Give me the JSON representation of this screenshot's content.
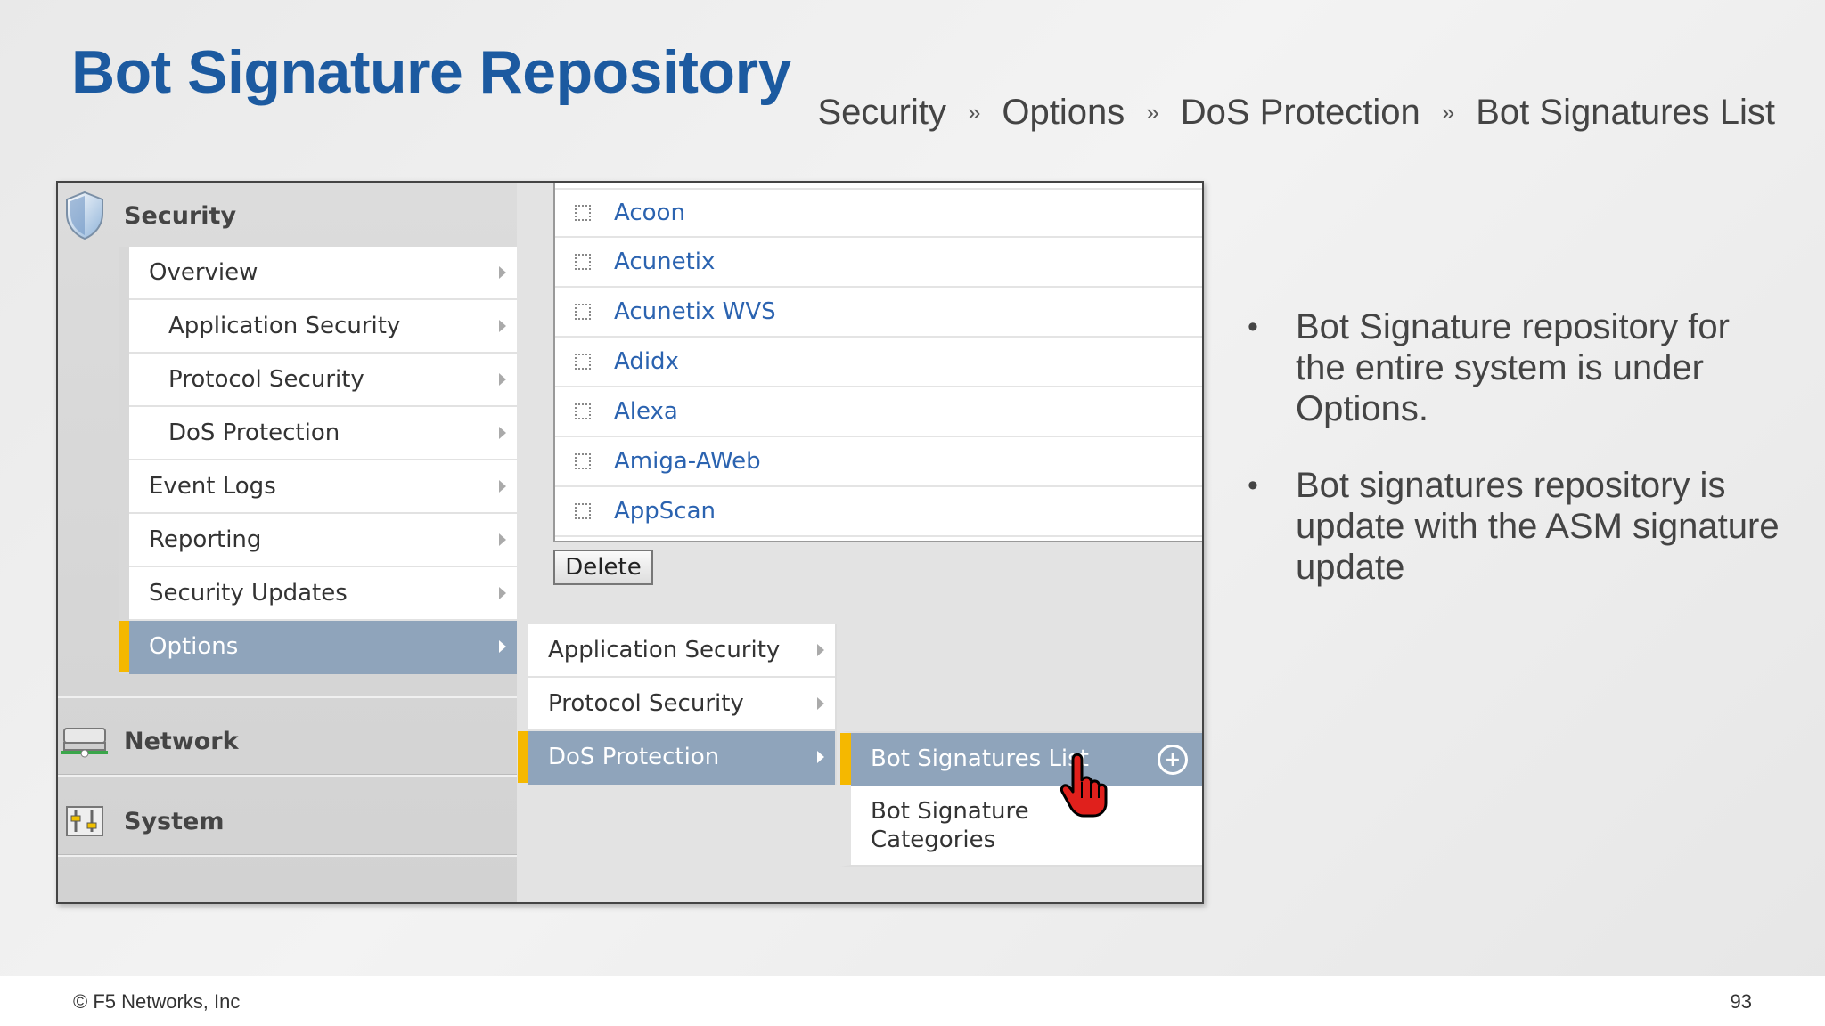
{
  "slide": {
    "title": "Bot Signature Repository",
    "breadcrumb": [
      "Security",
      "Options",
      "DoS Protection",
      "Bot Signatures List"
    ],
    "breadcrumb_separator": "»",
    "bullets": [
      "Bot Signature repository for the entire system is under Options.",
      "Bot signatures repository is update with the ASM signature update"
    ],
    "bullet_glyph": "•",
    "copyright": "© F5 Networks, Inc",
    "page_number": "93"
  },
  "screenshot": {
    "nav": {
      "security_label": "Security",
      "network_label": "Network",
      "system_label": "System",
      "security_items": [
        {
          "label": "Overview"
        },
        {
          "label": "Application Security"
        },
        {
          "label": "Protocol Security"
        },
        {
          "label": "DoS Protection"
        },
        {
          "label": "Event Logs"
        },
        {
          "label": "Reporting"
        },
        {
          "label": "Security Updates"
        },
        {
          "label": "Options"
        }
      ]
    },
    "signature_list": [
      "Acoon",
      "Acunetix",
      "Acunetix WVS",
      "Adidx",
      "Alexa",
      "Amiga-AWeb",
      "AppScan"
    ],
    "delete_label": "Delete",
    "options_submenu": [
      "Application Security",
      "Protocol Security",
      "DoS Protection"
    ],
    "dos_submenu": [
      "Bot Signatures List",
      "Bot Signature Categories"
    ],
    "colors": {
      "selected": "#8fa4bb",
      "accent": "#f5b800",
      "link": "#2b63b0",
      "title": "#1c5aa0"
    }
  }
}
